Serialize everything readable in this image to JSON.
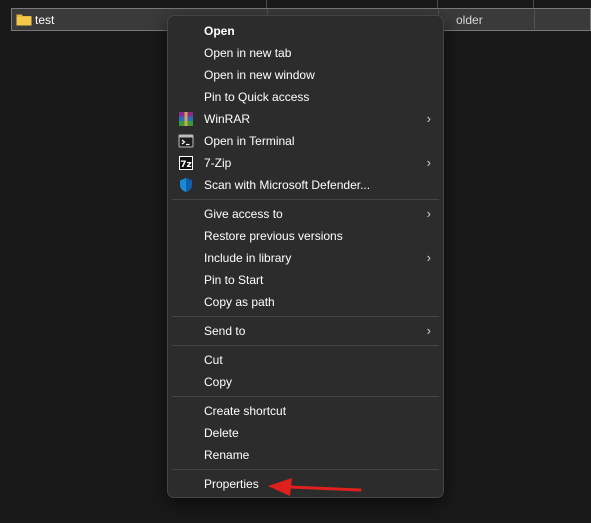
{
  "file_row": {
    "name": "test",
    "type_fragment": "older"
  },
  "menu": {
    "group1": [
      {
        "label": "Open"
      },
      {
        "label": "Open in new tab"
      },
      {
        "label": "Open in new window"
      },
      {
        "label": "Pin to Quick access"
      },
      {
        "label": "WinRAR",
        "icon": "winrar-icon",
        "submenu": true
      },
      {
        "label": "Open in Terminal",
        "icon": "terminal-icon"
      },
      {
        "label": "7-Zip",
        "icon": "7zip-icon",
        "submenu": true
      },
      {
        "label": "Scan with Microsoft Defender...",
        "icon": "defender-shield-icon"
      }
    ],
    "group2": [
      {
        "label": "Give access to",
        "submenu": true
      },
      {
        "label": "Restore previous versions"
      },
      {
        "label": "Include in library",
        "submenu": true
      },
      {
        "label": "Pin to Start"
      },
      {
        "label": "Copy as path"
      }
    ],
    "group3": [
      {
        "label": "Send to",
        "submenu": true
      }
    ],
    "group4": [
      {
        "label": "Cut"
      },
      {
        "label": "Copy"
      }
    ],
    "group5": [
      {
        "label": "Create shortcut"
      },
      {
        "label": "Delete"
      },
      {
        "label": "Rename"
      }
    ],
    "group6": [
      {
        "label": "Properties"
      }
    ],
    "submenu_glyph": "›"
  },
  "colors": {
    "background": "#191919",
    "menu_bg": "#2c2c2c",
    "selected_row": "#3a3a3a",
    "annotation_arrow": "#e0201d",
    "folder_yellow": "#f3c74a"
  }
}
